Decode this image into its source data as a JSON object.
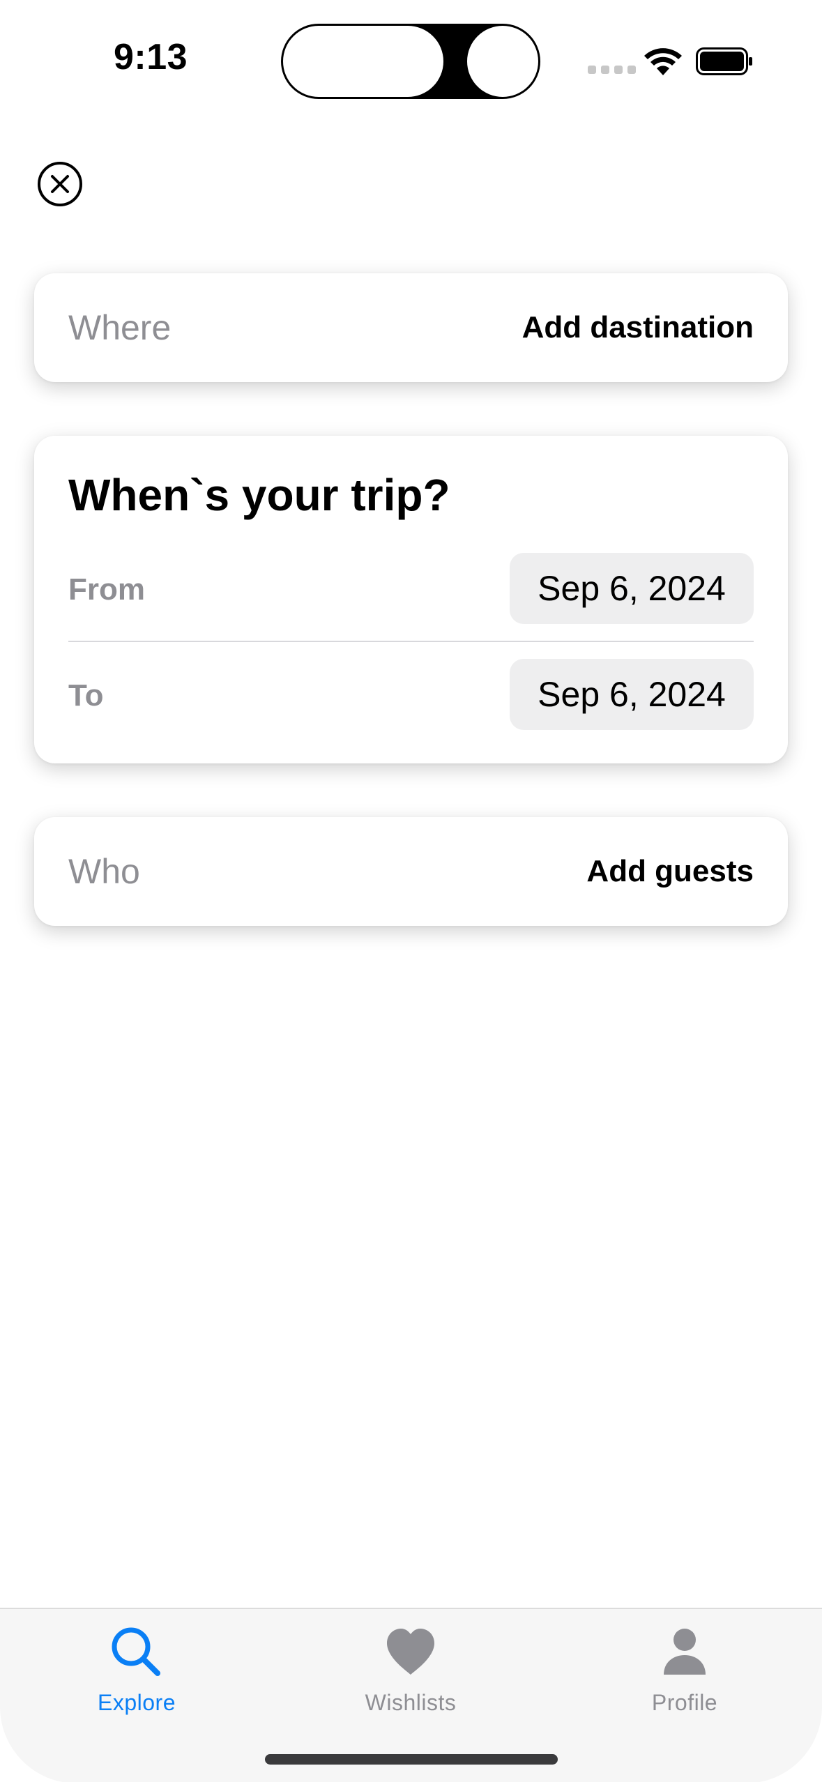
{
  "status_bar": {
    "time": "9:13"
  },
  "close_button": {
    "icon": "close-circle-icon"
  },
  "where": {
    "label": "Where",
    "action": "Add dastination"
  },
  "when": {
    "title": "When`s your trip?",
    "from_label": "From",
    "from_value": "Sep 6, 2024",
    "to_label": "To",
    "to_value": "Sep 6, 2024"
  },
  "who": {
    "label": "Who",
    "action": "Add guests"
  },
  "tab_bar": {
    "tabs": [
      {
        "label": "Explore",
        "icon": "search-icon",
        "active": true,
        "color": "#0a7ff5"
      },
      {
        "label": "Wishlists",
        "icon": "heart-icon",
        "active": false,
        "color": "#8e8e93"
      },
      {
        "label": "Profile",
        "icon": "person-icon",
        "active": false,
        "color": "#8e8e93"
      }
    ]
  },
  "colors": {
    "accent": "#0a7ff5",
    "secondary_text": "#8e8e93",
    "pill_background": "#eeeeef"
  }
}
